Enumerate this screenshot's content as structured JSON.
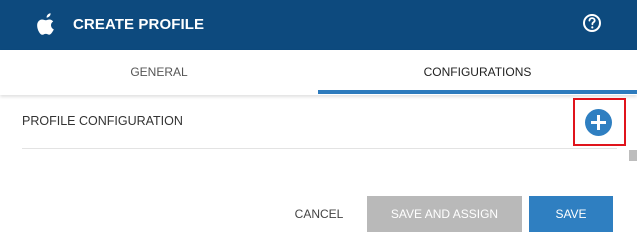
{
  "header": {
    "title": "CREATE PROFILE",
    "logo_icon": "apple-logo-icon",
    "help_icon": "question-circle-icon",
    "background": "#0d4a7e"
  },
  "tabs": [
    {
      "label": "GENERAL",
      "active": false
    },
    {
      "label": "CONFIGURATIONS",
      "active": true
    }
  ],
  "section": {
    "label": "PROFILE CONFIGURATION",
    "add_icon": "plus-circle-icon"
  },
  "footer": {
    "cancel_label": "CANCEL",
    "save_assign_label": "SAVE AND ASSIGN",
    "save_label": "SAVE"
  },
  "colors": {
    "accent": "#2f7fc1",
    "highlight": "#e0141c",
    "disabled": "#b9b9b9"
  }
}
